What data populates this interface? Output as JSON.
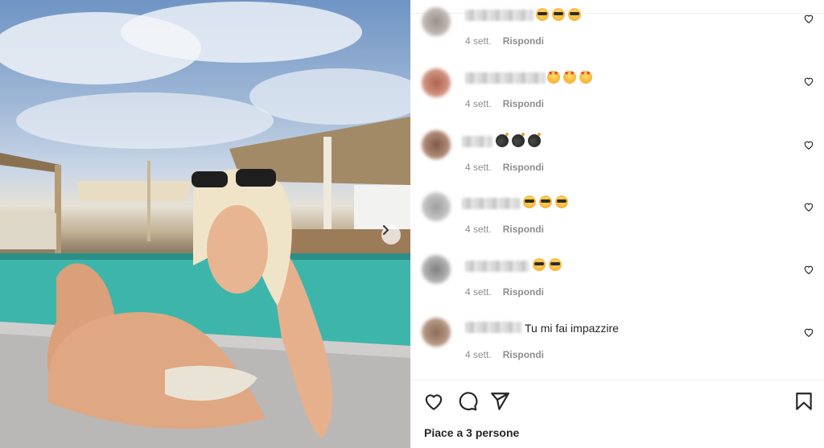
{
  "post": {
    "image_alt": "photo",
    "next_icon": "chevron-right-icon"
  },
  "comments": [
    {
      "time": "4 sett.",
      "reply": "Rispondi",
      "emojis": [
        "sun",
        "sun",
        "sun"
      ],
      "text": ""
    },
    {
      "time": "4 sett.",
      "reply": "Rispondi",
      "emojis": [
        "star",
        "star",
        "star"
      ],
      "text": ""
    },
    {
      "time": "4 sett.",
      "reply": "Rispondi",
      "emojis": [
        "bomb",
        "bomb",
        "bomb"
      ],
      "text": ""
    },
    {
      "time": "4 sett.",
      "reply": "Rispondi",
      "emojis": [
        "sun",
        "sun",
        "sun"
      ],
      "text": ""
    },
    {
      "time": "4 sett.",
      "reply": "Rispondi",
      "emojis": [
        "sun",
        "sun"
      ],
      "text": ""
    },
    {
      "time": "4 sett.",
      "reply": "Rispondi",
      "emojis": [],
      "text": "Tu mi fai impazzire"
    }
  ],
  "actions": {
    "like_icon": "heart-icon",
    "comment_icon": "comment-icon",
    "share_icon": "paper-plane-icon",
    "save_icon": "bookmark-icon"
  },
  "likes_text": "Piace a 3 persone",
  "colors": {
    "text": "#262626",
    "secondary": "#8e8e8e",
    "divider": "#efefef"
  }
}
